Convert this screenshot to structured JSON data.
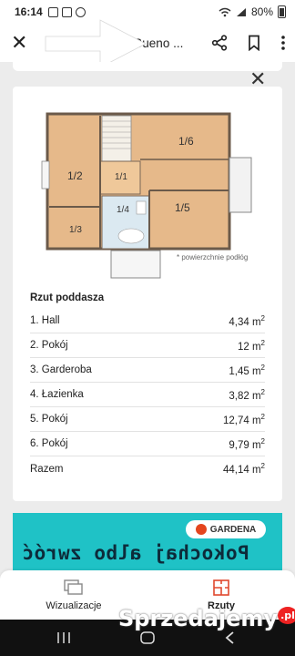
{
  "status_bar": {
    "time": "16:14",
    "battery": "80%"
  },
  "header": {
    "title": "Projekt domu Bueno ..."
  },
  "plan_caption": "* powierzchnie podłóg",
  "room_labels": [
    "1/1",
    "1/2",
    "1/3",
    "1/4",
    "1/5",
    "1/6"
  ],
  "rooms": {
    "title": "Rzut poddasza",
    "items": [
      {
        "name": "1. Hall",
        "area": "4,34 m",
        "unit": "2"
      },
      {
        "name": "2. Pokój",
        "area": "12 m",
        "unit": "2"
      },
      {
        "name": "3. Garderoba",
        "area": "1,45 m",
        "unit": "2"
      },
      {
        "name": "4. Łazienka",
        "area": "3,82 m",
        "unit": "2"
      },
      {
        "name": "5. Pokój",
        "area": "12,74 m",
        "unit": "2"
      },
      {
        "name": "6. Pokój",
        "area": "9,79 m",
        "unit": "2"
      },
      {
        "name": "Razem",
        "area": "44,14 m",
        "unit": "2"
      }
    ]
  },
  "banner": {
    "brand": "GARDENA",
    "slogan": "Pokochaj albo zwróć"
  },
  "bottom_nav": [
    {
      "label": "Wizualizacje",
      "icon": "gallery-icon",
      "active": false
    },
    {
      "label": "Rzuty",
      "icon": "floor-plan-icon",
      "active": true
    }
  ],
  "watermark": {
    "text": "Sprzedajemy",
    "suffix": ".pl"
  },
  "colors": {
    "accent_active": "#e0492f",
    "banner_bg": "#1fc2c6",
    "plan_floor": "#e6b98a"
  }
}
